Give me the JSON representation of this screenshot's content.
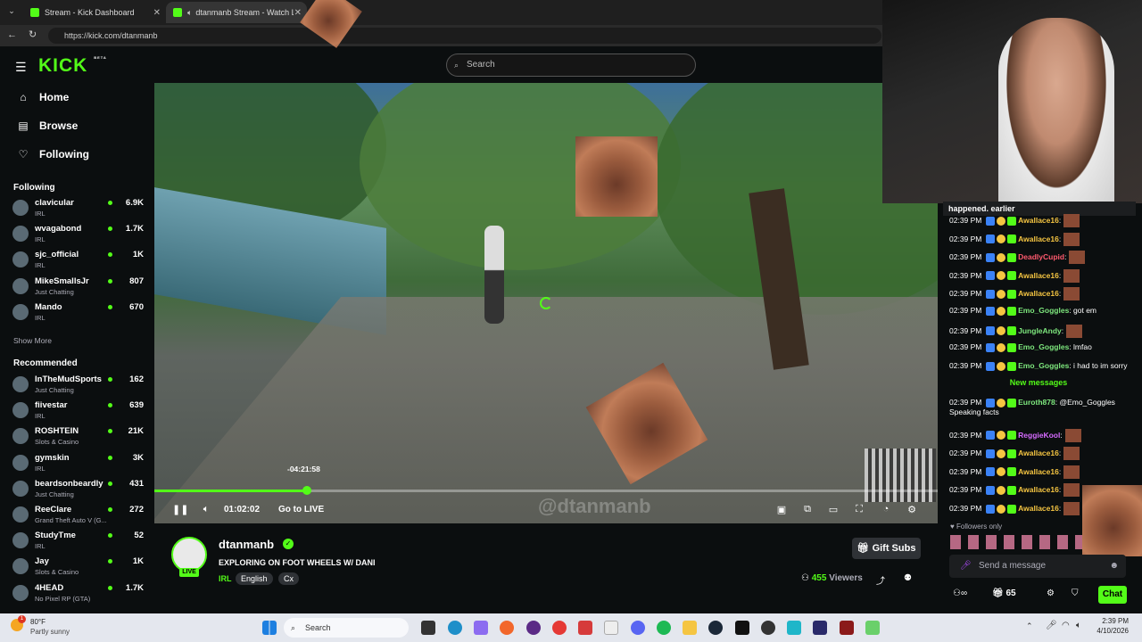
{
  "browser": {
    "tabs": [
      {
        "title": "Stream - Kick Dashboard"
      },
      {
        "title": "dtanmanb Stream - Watch Li"
      }
    ],
    "url": "https://kick.com/dtanmanb"
  },
  "site": {
    "logo": "KICK",
    "logo_badge": "BETA",
    "search_placeholder": "Search"
  },
  "nav": [
    {
      "label": "Home",
      "icon": "home-icon"
    },
    {
      "label": "Browse",
      "icon": "browse-icon"
    },
    {
      "label": "Following",
      "icon": "heart-icon"
    }
  ],
  "following_title": "Following",
  "following": [
    {
      "name": "clavicular",
      "category": "IRL",
      "viewers": "6.9K"
    },
    {
      "name": "wvagabond",
      "category": "IRL",
      "viewers": "1.7K"
    },
    {
      "name": "sjc_official",
      "category": "IRL",
      "viewers": "1K"
    },
    {
      "name": "MikeSmallsJr",
      "category": "Just Chatting",
      "viewers": "807"
    },
    {
      "name": "Mando",
      "category": "IRL",
      "viewers": "670"
    }
  ],
  "show_more": "Show More",
  "recommended_title": "Recommended",
  "recommended": [
    {
      "name": "InTheMudSports",
      "category": "Just Chatting",
      "viewers": "162"
    },
    {
      "name": "fiivestar",
      "category": "IRL",
      "viewers": "639"
    },
    {
      "name": "ROSHTEIN",
      "category": "Slots & Casino",
      "viewers": "21K"
    },
    {
      "name": "gymskin",
      "category": "IRL",
      "viewers": "3K"
    },
    {
      "name": "beardsonbeardly",
      "category": "Just Chatting",
      "viewers": "431"
    },
    {
      "name": "ReeClare",
      "category": "Grand Theft Auto V (G...",
      "viewers": "272"
    },
    {
      "name": "StudyTme",
      "category": "IRL",
      "viewers": "52"
    },
    {
      "name": "Jay",
      "category": "Slots & Casino",
      "viewers": "1K"
    },
    {
      "name": "4HEAD",
      "category": "No Pixel RP (GTA)",
      "viewers": "1.7K"
    }
  ],
  "player": {
    "hover_time": "-04:21:58",
    "current_time": "01:02:02",
    "go_live": "Go to LIVE",
    "progress": 0.19,
    "watermark": "@dtanmanb"
  },
  "stream": {
    "channel": "dtanmanb",
    "title": "EXPLORING ON FOOT WHEELS W/ DANI",
    "live_label": "LIVE",
    "tags": [
      "IRL",
      "English",
      "Cx"
    ],
    "viewers": "455",
    "viewers_label": "Viewers",
    "gift_label": "Gift Subs"
  },
  "chat": {
    "pinned_text": "happened. earlier",
    "messages": [
      {
        "time": "02:39 PM",
        "user": "Awallace16",
        "text": ":",
        "color": "#f5c542"
      },
      {
        "time": "02:39 PM",
        "user": "Awallace16",
        "text": ":",
        "color": "#f5c542"
      },
      {
        "time": "02:39 PM",
        "user": "DeadlyCupid",
        "text": ":",
        "color": "#ff5a6e"
      },
      {
        "time": "02:39 PM",
        "user": "Awallace16",
        "text": ":",
        "color": "#f5c542"
      },
      {
        "time": "02:39 PM",
        "user": "Awallace16",
        "text": ":",
        "color": "#f5c542"
      },
      {
        "time": "02:39 PM",
        "user": "Emo_Goggles",
        "text": ": got em",
        "color": "#7ee87e"
      },
      {
        "time": "02:39 PM",
        "user": "JungleAndy",
        "text": ":",
        "color": "#7ee87e"
      },
      {
        "time": "02:39 PM",
        "user": "Emo_Goggles",
        "text": ": lmfao",
        "color": "#7ee87e"
      },
      {
        "time": "02:39 PM",
        "user": "Emo_Goggles",
        "text": ": i had to im sorry",
        "color": "#7ee87e"
      }
    ],
    "new_messages_label": "New messages",
    "new_messages": [
      {
        "time": "02:39 PM",
        "user": "Euroth878",
        "text": ": @Emo_Goggles",
        "text2": "Speaking facts",
        "color": "#7ee87e"
      },
      {
        "time": "02:39 PM",
        "user": "ReggieKool",
        "text": ":",
        "color": "#d66bff"
      },
      {
        "time": "02:39 PM",
        "user": "Awallace16",
        "text": ":",
        "color": "#f5c542"
      },
      {
        "time": "02:39 PM",
        "user": "Awallace16",
        "text": ":",
        "color": "#f5c542"
      },
      {
        "time": "02:39 PM",
        "user": "Awallace16",
        "text": ":",
        "color": "#f5c542"
      },
      {
        "time": "02:39 PM",
        "user": "Awallace16",
        "text": ":",
        "color": "#f5c542"
      }
    ],
    "followers_only": "Followers only",
    "send_placeholder": "Send a message",
    "points": "65",
    "chat_button": "Chat"
  },
  "taskbar": {
    "temp": "80°F",
    "weather": "Partly sunny",
    "search": "Search",
    "time": "2:39 PM",
    "date": "4/10/2026",
    "notif_count": "1"
  },
  "colors": {
    "accent": "#53fc18",
    "background": "#0b0e0f"
  }
}
